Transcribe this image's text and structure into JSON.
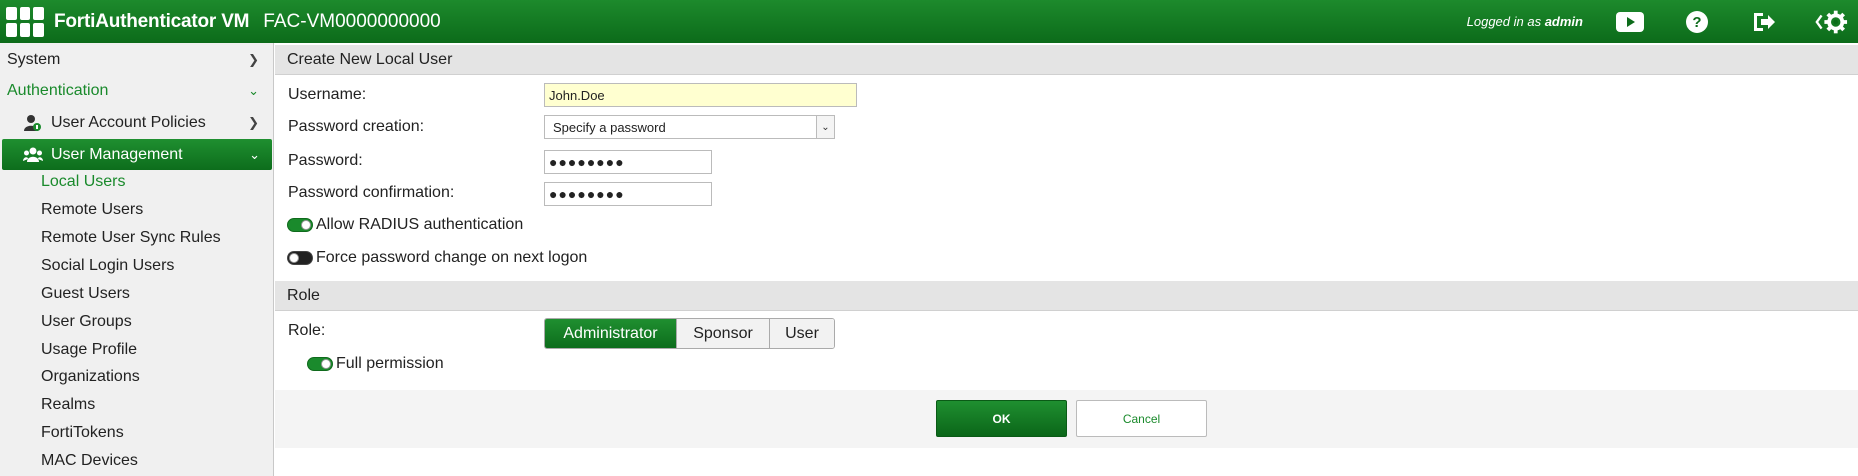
{
  "header": {
    "product": "FortiAuthenticator VM",
    "serial": "FAC-VM0000000000",
    "logged_prefix": "Logged in as",
    "user": "admin",
    "icons": [
      "video-icon",
      "help-icon",
      "logout-icon",
      "settings-icon"
    ]
  },
  "sidebar": {
    "system": "System",
    "authentication": "Authentication",
    "user_account_policies": "User Account Policies",
    "user_management": "User Management",
    "sub_items": [
      "Local Users",
      "Remote Users",
      "Remote User Sync Rules",
      "Social Login Users",
      "Guest Users",
      "User Groups",
      "Usage Profile",
      "Organizations",
      "Realms",
      "FortiTokens",
      "MAC Devices"
    ],
    "active_sub": "Local Users"
  },
  "form": {
    "title": "Create New Local User",
    "username_label": "Username:",
    "username_value": "John.Doe",
    "password_creation_label": "Password creation:",
    "password_creation_value": "Specify a password",
    "password_label": "Password:",
    "password_value": "●●●●●●●●",
    "password_confirm_label": "Password confirmation:",
    "password_confirm_value": "●●●●●●●●",
    "allow_radius_label": "Allow RADIUS authentication",
    "allow_radius_on": true,
    "force_pw_label": "Force password change on next logon",
    "force_pw_on": false
  },
  "role": {
    "section_title": "Role",
    "label": "Role:",
    "options": [
      "Administrator",
      "Sponsor",
      "User"
    ],
    "selected": "Administrator",
    "full_permission_label": "Full permission",
    "full_permission_on": true
  },
  "buttons": {
    "ok": "OK",
    "cancel": "Cancel"
  },
  "colors": {
    "brand_green": "#1a8a2c",
    "header_green": "#0c6b1a",
    "input_highlight": "#ffffd0"
  }
}
